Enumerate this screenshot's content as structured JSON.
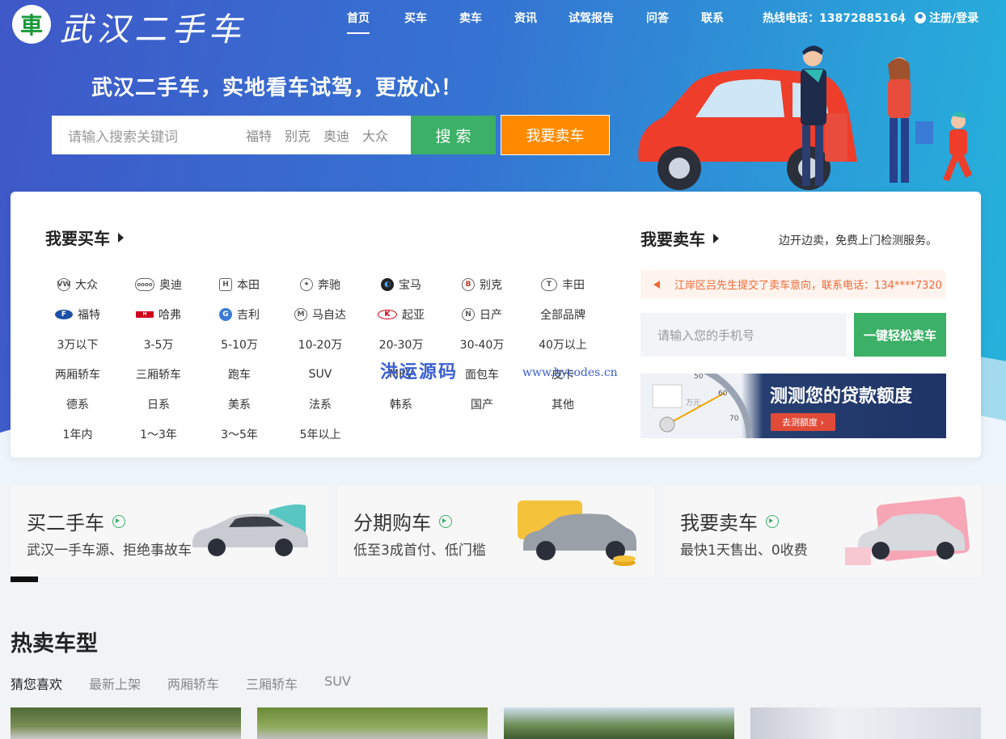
{
  "header": {
    "logo_mark": "車",
    "logo_text": "武汉二手车",
    "nav": [
      {
        "label": "首页",
        "active": true
      },
      {
        "label": "买车",
        "active": false
      },
      {
        "label": "卖车",
        "active": false
      },
      {
        "label": "资讯",
        "active": false
      },
      {
        "label": "试驾报告",
        "active": false
      },
      {
        "label": "问答",
        "active": false
      },
      {
        "label": "联系",
        "active": false
      }
    ],
    "hotline": "热线电话：13872885164",
    "login": "注册/登录"
  },
  "hero": {
    "slogan": "武汉二手车，实地看车试驾，更放心！",
    "search_placeholder": "请输入搜索关键词",
    "search_tags": [
      "福特",
      "别克",
      "奥迪",
      "大众"
    ],
    "search_button": "搜 索",
    "sell_button": "我要卖车"
  },
  "buy": {
    "title": "我要买车",
    "rows": [
      [
        {
          "t": "大众",
          "i": "VW"
        },
        {
          "t": "奥迪",
          "i": "oooo"
        },
        {
          "t": "本田",
          "i": "H"
        },
        {
          "t": "奔驰",
          "i": "✦"
        },
        {
          "t": "宝马",
          "i": "◐"
        },
        {
          "t": "别克",
          "i": "B"
        },
        {
          "t": "丰田",
          "i": "T"
        }
      ],
      [
        {
          "t": "福特",
          "i": "F"
        },
        {
          "t": "哈弗",
          "i": "H"
        },
        {
          "t": "吉利",
          "i": "G"
        },
        {
          "t": "马自达",
          "i": "M"
        },
        {
          "t": "起亚",
          "i": "K"
        },
        {
          "t": "日产",
          "i": "N"
        },
        {
          "t": "全部品牌",
          "i": ""
        }
      ],
      [
        {
          "t": "3万以下"
        },
        {
          "t": "3-5万"
        },
        {
          "t": "5-10万"
        },
        {
          "t": "10-20万"
        },
        {
          "t": "20-30万"
        },
        {
          "t": "30-40万"
        },
        {
          "t": "40万以上"
        }
      ],
      [
        {
          "t": "两厢轿车"
        },
        {
          "t": "三厢轿车"
        },
        {
          "t": "跑车"
        },
        {
          "t": "SUV"
        },
        {
          "t": "MPV"
        },
        {
          "t": "面包车"
        },
        {
          "t": "皮卡"
        }
      ],
      [
        {
          "t": "德系"
        },
        {
          "t": "日系"
        },
        {
          "t": "美系"
        },
        {
          "t": "法系"
        },
        {
          "t": "韩系"
        },
        {
          "t": "国产"
        },
        {
          "t": "其他"
        }
      ],
      [
        {
          "t": "1年内"
        },
        {
          "t": "1～3年"
        },
        {
          "t": "3～5年"
        },
        {
          "t": "5年以上"
        }
      ]
    ]
  },
  "sell": {
    "title": "我要卖车",
    "note": "边开边卖，免费上门检测服务。",
    "notice": "江岸区吕先生提交了卖车意向，联系电话：134****7320",
    "phone_placeholder": "请输入您的手机号",
    "submit": "一键轻松卖车",
    "loan_title": "测测您的贷款额度",
    "loan_button": "去测额度 ›",
    "gauge_ticks": [
      "50",
      "60",
      "70"
    ],
    "gauge_unit": "万元"
  },
  "watermark": {
    "cn": "洪运源码",
    "url": "www.hycodes.cn"
  },
  "cards": [
    {
      "title": "买二手车",
      "sub": "武汉一手车源、拒绝事故车"
    },
    {
      "title": "分期购车",
      "sub": "低至3成首付、低门槛"
    },
    {
      "title": "我要卖车",
      "sub": "最快1天售出、0收费"
    }
  ],
  "hot": {
    "title": "热卖车型",
    "tabs": [
      {
        "label": "猜您喜欢",
        "active": true
      },
      {
        "label": "最新上架",
        "active": false
      },
      {
        "label": "两厢轿车",
        "active": false
      },
      {
        "label": "三厢轿车",
        "active": false
      },
      {
        "label": "SUV",
        "active": false
      }
    ]
  }
}
